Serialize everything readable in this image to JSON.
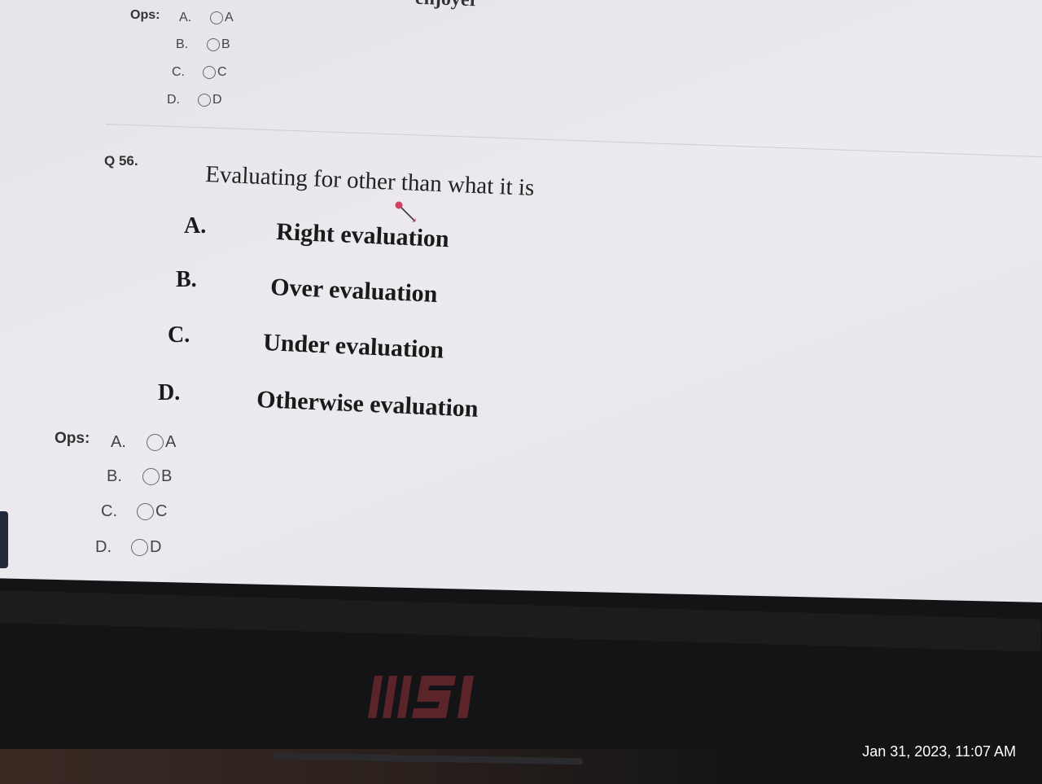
{
  "previous_question": {
    "cut_off_text": "enjoyer",
    "ops_label": "Ops:",
    "options": [
      {
        "letter": "A.",
        "choice": "A"
      },
      {
        "letter": "B.",
        "choice": "B"
      },
      {
        "letter": "C.",
        "choice": "C"
      },
      {
        "letter": "D.",
        "choice": "D"
      }
    ]
  },
  "question": {
    "number": "Q 56.",
    "text": "Evaluating for other than what it is",
    "options": [
      {
        "letter": "A.",
        "text": "Right evaluation"
      },
      {
        "letter": "B.",
        "text": "Over evaluation"
      },
      {
        "letter": "C.",
        "text": "Under evaluation"
      },
      {
        "letter": "D.",
        "text": "Otherwise evaluation"
      }
    ],
    "ops_label": "Ops:",
    "answer_choices": [
      {
        "letter": "A.",
        "choice": "A"
      },
      {
        "letter": "B.",
        "choice": "B"
      },
      {
        "letter": "C.",
        "choice": "C"
      },
      {
        "letter": "D.",
        "choice": "D"
      }
    ]
  },
  "device": {
    "brand": "MSI"
  },
  "photo_timestamp": "Jan 31, 2023, 11:07 AM",
  "colors": {
    "screen_bg": "#e8e6ea",
    "bezel": "#141416",
    "cursor": "#d04060",
    "logo": "#5a2428"
  }
}
